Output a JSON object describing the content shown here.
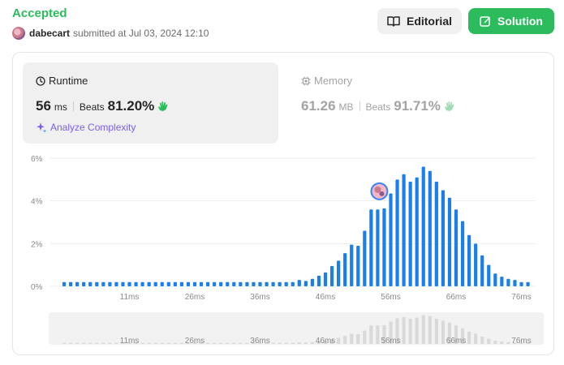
{
  "submission": {
    "status": "Accepted",
    "username": "dabecart",
    "submitted_text": "submitted at Jul 03, 2024 12:10"
  },
  "buttons": {
    "editorial": "Editorial",
    "solution": "Solution"
  },
  "runtime": {
    "label": "Runtime",
    "value": "56",
    "unit": "ms",
    "beats_label": "Beats",
    "beats_value": "81.20%",
    "analyze_label": "Analyze Complexity"
  },
  "memory": {
    "label": "Memory",
    "value": "61.26",
    "unit": "MB",
    "beats_label": "Beats",
    "beats_value": "91.71%"
  },
  "colors": {
    "accepted": "#2cbb5d",
    "bar": "#1a7fe8",
    "bar_muted": "#d9d9d9",
    "analyze": "#7c5cf0"
  },
  "chart_data": {
    "type": "bar",
    "ylabel": "",
    "xlabel": "",
    "ylim": [
      0,
      6
    ],
    "yticks": [
      "0%",
      "2%",
      "4%",
      "6%"
    ],
    "ytick_values": [
      0,
      2,
      4,
      6
    ],
    "x_tick_labels": [
      "11ms",
      "26ms",
      "36ms",
      "46ms",
      "56ms",
      "66ms",
      "76ms"
    ],
    "x_tick_bar_index": [
      10,
      20,
      30,
      40,
      50,
      60,
      70
    ],
    "highlight_bar_index": 49,
    "values": [
      0.2,
      0.2,
      0.2,
      0.2,
      0.2,
      0.2,
      0.2,
      0.2,
      0.2,
      0.2,
      0.2,
      0.2,
      0.2,
      0.2,
      0.2,
      0.2,
      0.2,
      0.2,
      0.2,
      0.2,
      0.2,
      0.2,
      0.2,
      0.2,
      0.2,
      0.2,
      0.2,
      0.2,
      0.2,
      0.2,
      0.2,
      0.2,
      0.2,
      0.2,
      0.2,
      0.2,
      0.3,
      0.25,
      0.35,
      0.5,
      0.65,
      0.95,
      1.2,
      1.55,
      1.95,
      1.9,
      2.6,
      3.6,
      3.6,
      3.65,
      4.35,
      5.0,
      5.25,
      4.9,
      5.1,
      5.6,
      5.4,
      4.9,
      4.5,
      4.15,
      3.6,
      3.05,
      2.4,
      2.0,
      1.45,
      1.0,
      0.6,
      0.45,
      0.35,
      0.3,
      0.2,
      0.2
    ]
  }
}
